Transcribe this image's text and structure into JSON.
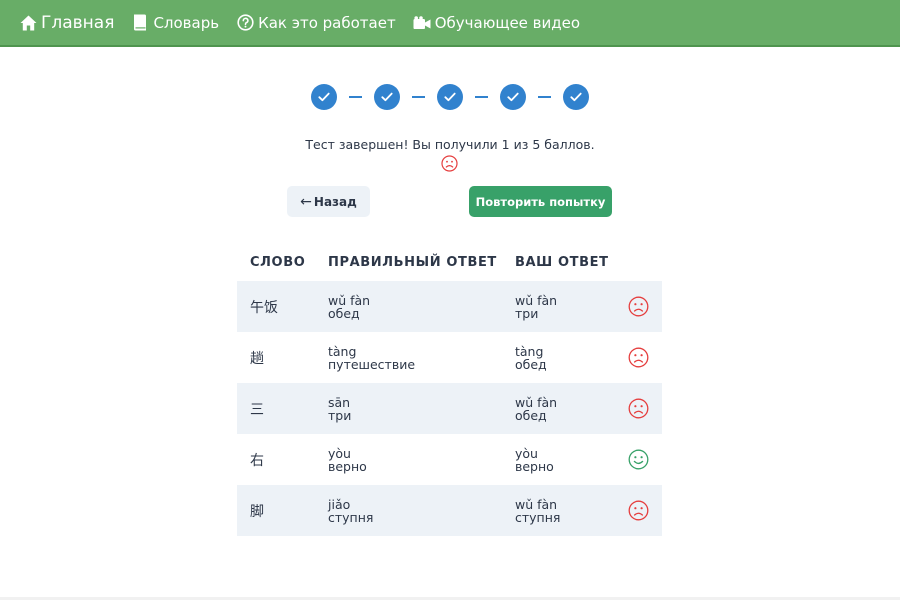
{
  "nav": {
    "items": [
      {
        "label": "Главная",
        "icon": "home-icon"
      },
      {
        "label": "Словарь",
        "icon": "book-icon"
      },
      {
        "label": "Как это работает",
        "icon": "question-circle-icon"
      },
      {
        "label": "Обучающее видео",
        "icon": "video-camera-icon"
      }
    ]
  },
  "progress": {
    "completed_steps": 5,
    "total_steps": 5,
    "step_icon": "checkmark-icon"
  },
  "result": {
    "message": "Тест завершен! Вы получили 1 из 5 баллов.",
    "face": "frown-icon"
  },
  "buttons": {
    "back": "Назад",
    "back_icon": "arrow-left-icon",
    "retry": "Повторить попытку"
  },
  "table": {
    "headers": [
      "СЛОВО",
      "ПРАВИЛЬНЫЙ ОТВЕТ",
      "ВАШ ОТВЕТ"
    ],
    "rows": [
      {
        "word": "午饭",
        "correct_pinyin": "wǔ fàn",
        "correct_meaning": "обед",
        "your_pinyin": "wǔ fàn",
        "your_meaning": "три",
        "result": "frown-icon"
      },
      {
        "word": "趟",
        "correct_pinyin": "tàng",
        "correct_meaning": "путешествие",
        "your_pinyin": "tàng",
        "your_meaning": "обед",
        "result": "frown-icon"
      },
      {
        "word": "三",
        "correct_pinyin": "sān",
        "correct_meaning": "три",
        "your_pinyin": "wǔ fàn",
        "your_meaning": "обед",
        "result": "frown-icon"
      },
      {
        "word": "右",
        "correct_pinyin": "yòu",
        "correct_meaning": "верно",
        "your_pinyin": "yòu",
        "your_meaning": "верно",
        "result": "smile-icon"
      },
      {
        "word": "脚",
        "correct_pinyin": "jiǎo",
        "correct_meaning": "ступня",
        "your_pinyin": "wǔ fàn",
        "your_meaning": "ступня",
        "result": "frown-icon"
      }
    ]
  },
  "colors": {
    "navbar": "#68ad67",
    "step": "#3182ce",
    "retry_button": "#38a169",
    "back_button": "#edf2f7",
    "row_shade": "#edf2f7",
    "frown": "#e53e3e",
    "smile": "#38a169"
  }
}
